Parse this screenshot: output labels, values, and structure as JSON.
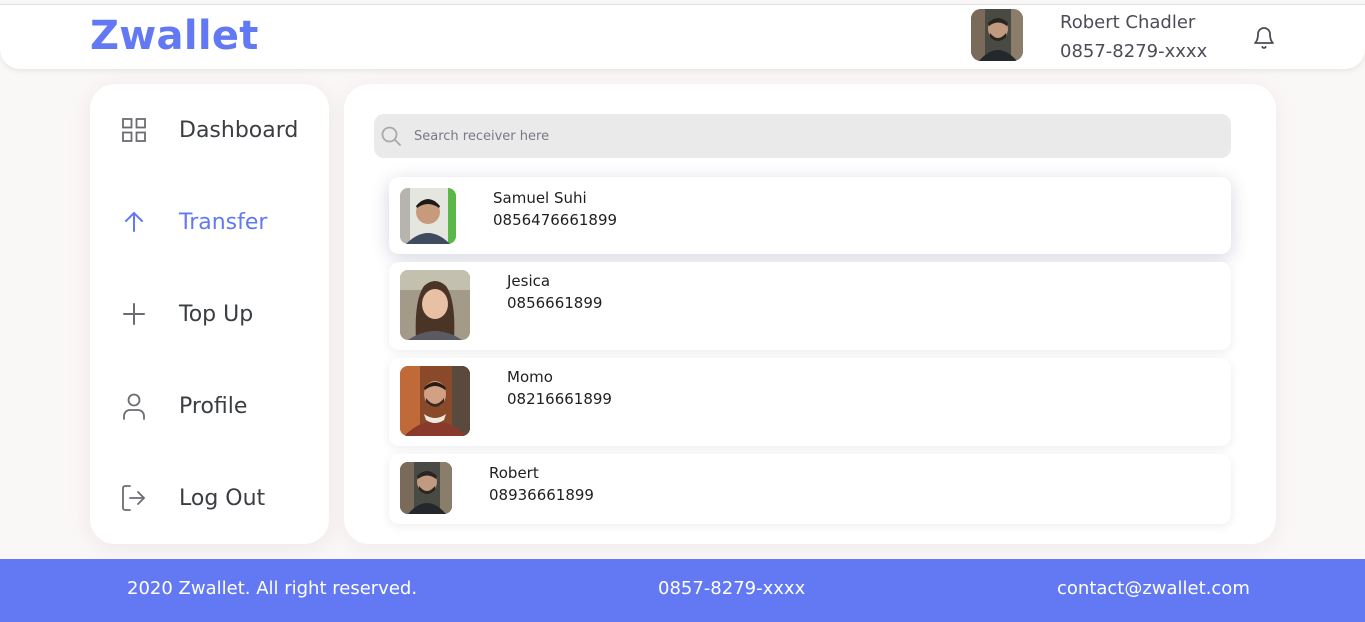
{
  "brand": {
    "name": "Zwallet"
  },
  "header": {
    "user_name": "Robert Chadler",
    "user_phone": "0857-8279-xxxx",
    "avatar_icon": "user-photo",
    "notification_icon": "bell-icon"
  },
  "sidebar": {
    "items": [
      {
        "label": "Dashboard",
        "icon": "grid-icon",
        "active": false
      },
      {
        "label": "Transfer",
        "icon": "arrow-up-icon",
        "active": true
      },
      {
        "label": "Top Up",
        "icon": "plus-icon",
        "active": false
      },
      {
        "label": "Profile",
        "icon": "user-icon",
        "active": false
      },
      {
        "label": "Log Out",
        "icon": "logout-icon",
        "active": false
      }
    ]
  },
  "search": {
    "placeholder": "Search receiver here",
    "value": ""
  },
  "contacts": [
    {
      "name": "Samuel Suhi",
      "phone": "0856476661899"
    },
    {
      "name": "Jesica",
      "phone": "0856661899"
    },
    {
      "name": "Momo",
      "phone": "08216661899"
    },
    {
      "name": "Robert",
      "phone": "08936661899"
    }
  ],
  "footer": {
    "copyright": "2020 Zwallet. All right reserved.",
    "phone": "0857-8279-xxxx",
    "email": "contact@zwallet.com"
  },
  "colors": {
    "accent": "#6379f4",
    "text": "#3a3d42",
    "background": "#faf7f7"
  }
}
